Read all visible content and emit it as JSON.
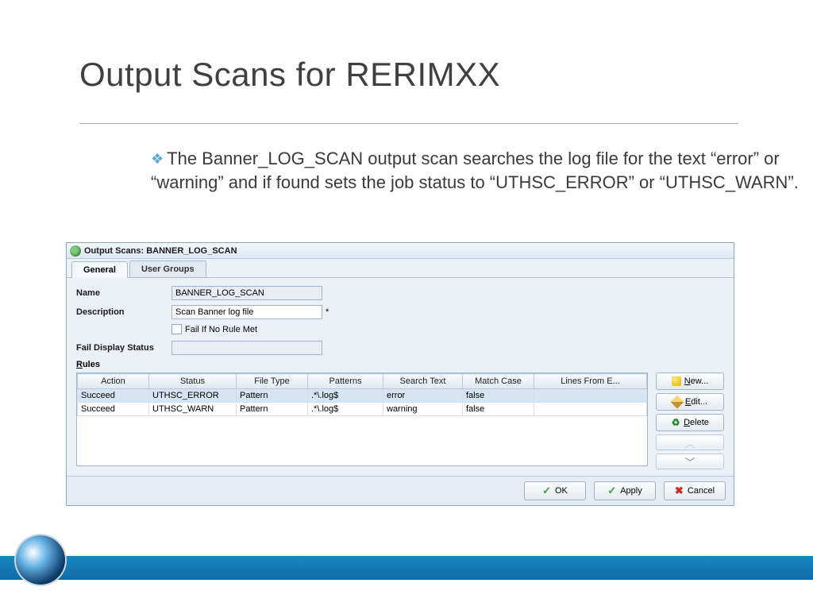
{
  "slide": {
    "title": "Output Scans for RERIMXX",
    "bullet": "The Banner_LOG_SCAN output scan searches the log file for the text “error” or “warning” and if found sets the job status to “UTHSC_ERROR” or “UTHSC_WARN”."
  },
  "window": {
    "title": "Output Scans: BANNER_LOG_SCAN",
    "tabs": {
      "general": "General",
      "user_groups": "User Groups"
    },
    "form": {
      "name_label": "Name",
      "name_value": "BANNER_LOG_SCAN",
      "desc_label": "Description",
      "desc_value": "Scan Banner log file",
      "req_mark": "*",
      "fail_if_label": "Fail If No Rule Met",
      "fail_display_label": "Fail Display Status",
      "fail_display_value": "",
      "rules_label": "Rules"
    },
    "grid": {
      "headers": [
        "Action",
        "Status",
        "File Type",
        "Patterns",
        "Search Text",
        "Match Case",
        "Lines From E..."
      ],
      "rows": [
        {
          "action": "Succeed",
          "status": "UTHSC_ERROR",
          "file_type": "Pattern",
          "patterns": ".*\\.log$",
          "search_text": "error",
          "match_case": "false",
          "lines_from_e": ""
        },
        {
          "action": "Succeed",
          "status": "UTHSC_WARN",
          "file_type": "Pattern",
          "patterns": ".*\\.log$",
          "search_text": "warning",
          "match_case": "false",
          "lines_from_e": ""
        }
      ]
    },
    "side_buttons": {
      "new": "New...",
      "edit": "Edit...",
      "delete": "Delete"
    },
    "footer_buttons": {
      "ok": "OK",
      "apply": "Apply",
      "cancel": "Cancel"
    }
  }
}
